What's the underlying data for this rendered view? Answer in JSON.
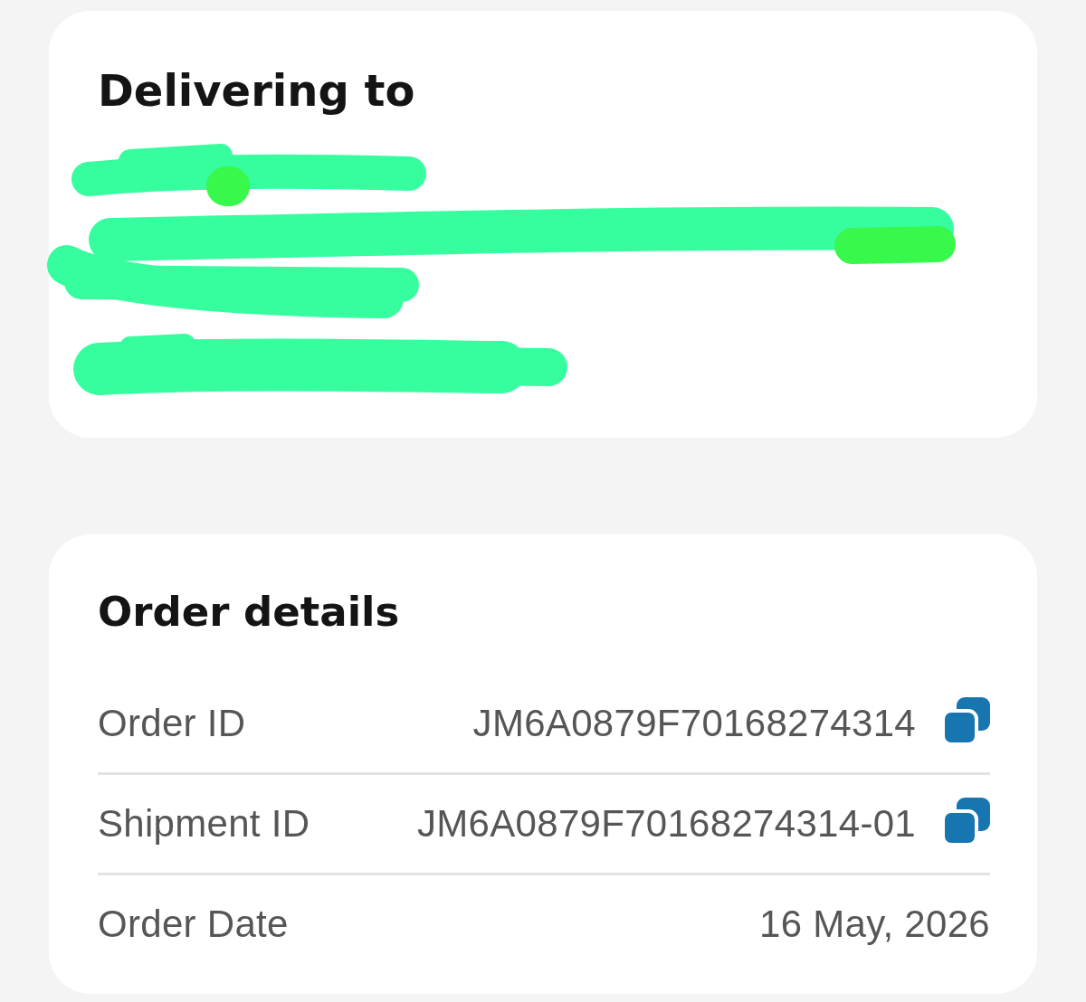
{
  "delivery": {
    "title": "Delivering to",
    "address_lines": [
      {
        "kind": "redacted"
      },
      {
        "kind": "redacted"
      },
      {
        "kind": "redacted"
      },
      {
        "kind": "redacted"
      }
    ]
  },
  "order_details": {
    "title": "Order details",
    "rows": [
      {
        "label": "Order ID",
        "value": "JM6A0879F70168274314",
        "copyable": true
      },
      {
        "label": "Shipment ID",
        "value": "JM6A0879F70168274314-01",
        "copyable": true
      },
      {
        "label": "Order Date",
        "value": "16 May, 2026",
        "copyable": false
      }
    ]
  }
}
